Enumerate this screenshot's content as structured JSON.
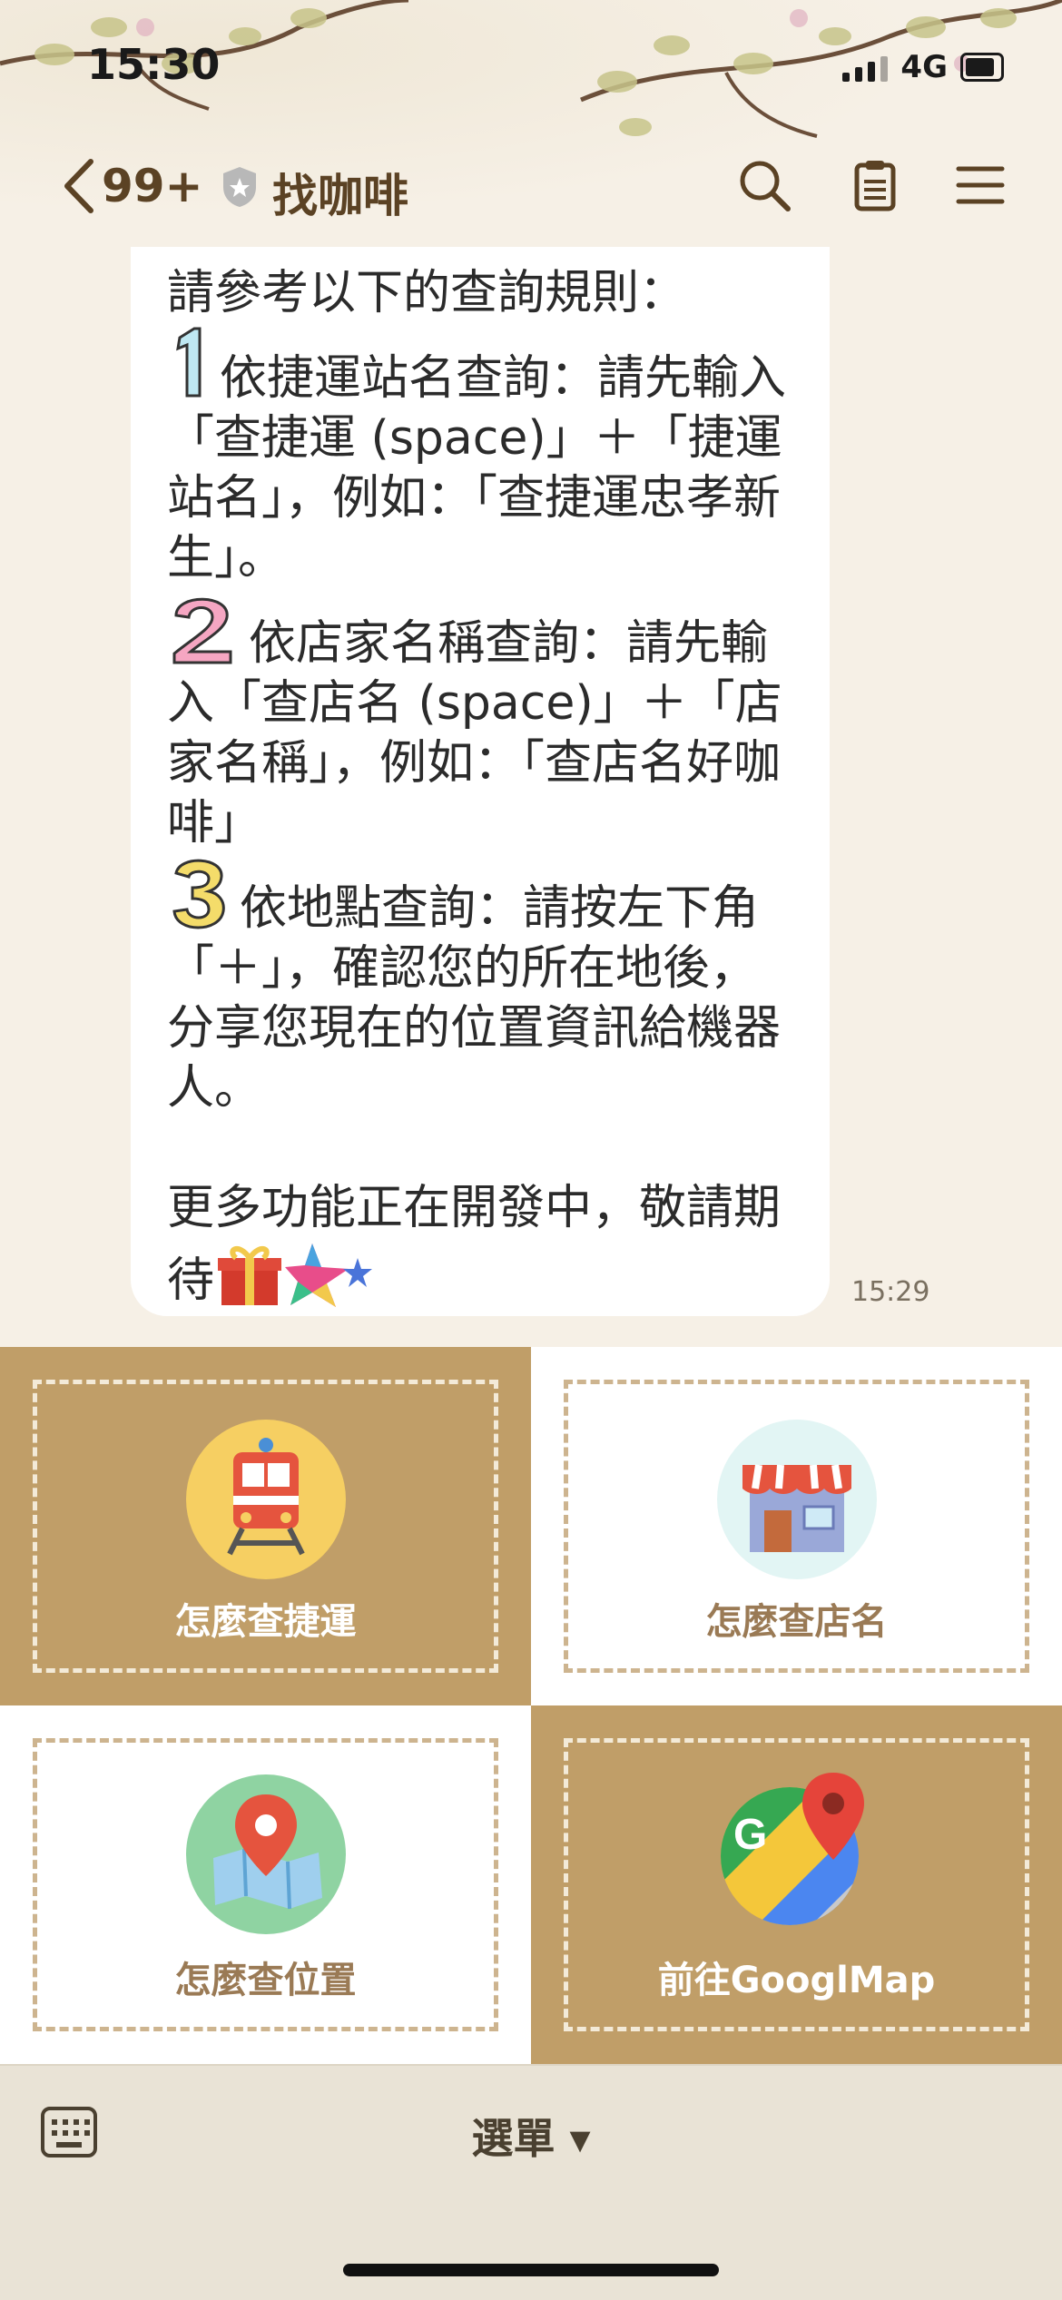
{
  "status": {
    "time": "15:30",
    "network": "4G"
  },
  "nav": {
    "unread_count": "99+",
    "title": "找咖啡"
  },
  "message": {
    "intro": "請參考以下的查詢規則：",
    "item1": "依捷運站名查詢：請先輸入「查捷運 (space)」＋「捷運站名」，例如：「查捷運忠孝新生」。",
    "item2": "依店家名稱查詢：請先輸入「查店名 (space)」＋「店家名稱」，例如：「查店名好咖啡」",
    "item3": "依地點查詢：請按左下角「＋」，確認您的所在地後，分享您現在的位置資訊給機器人。",
    "outro": "更多功能正在開發中，敬請期待",
    "time": "15:29"
  },
  "rich_menu": {
    "tiles": [
      {
        "label": "怎麼查捷運",
        "icon": "train-icon",
        "style": "tan"
      },
      {
        "label": "怎麼查店名",
        "icon": "shop-icon",
        "style": "white"
      },
      {
        "label": "怎麼查位置",
        "icon": "map-pin-icon",
        "style": "white"
      },
      {
        "label": "前往GooglMap",
        "icon": "google-maps-icon",
        "style": "tan"
      }
    ]
  },
  "bottom_bar": {
    "menu_label": "選單 ▾"
  },
  "colors": {
    "tan": "#c09e68",
    "brown_text": "#5b4224",
    "bubble": "#ffffff"
  }
}
